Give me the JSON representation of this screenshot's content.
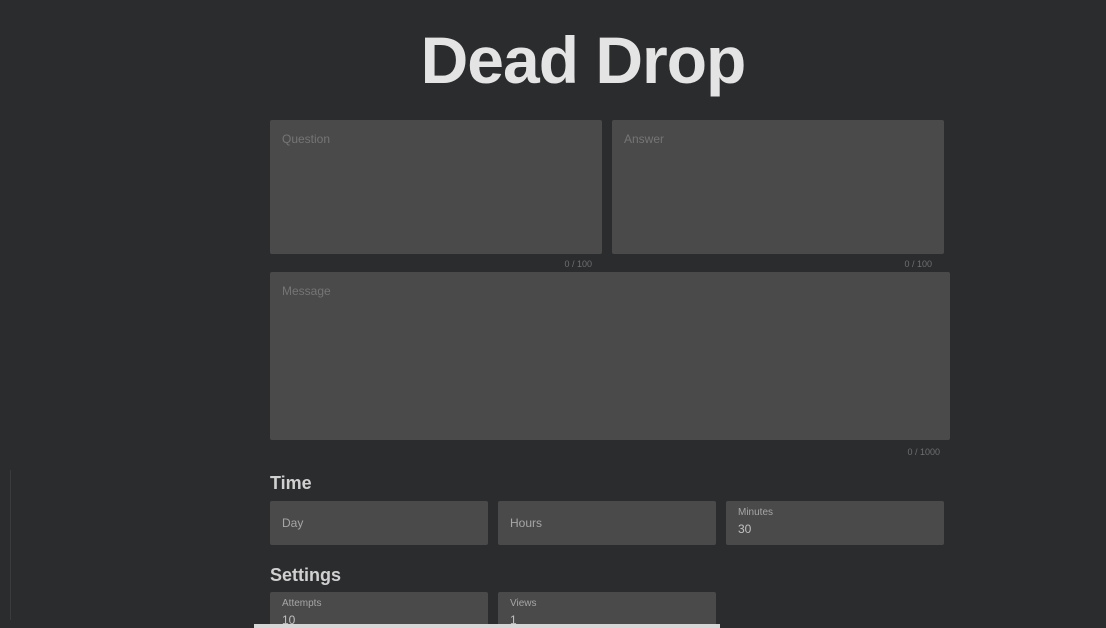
{
  "app": {
    "title": "Dead Drop"
  },
  "top_fields": {
    "question": {
      "placeholder": "Question",
      "counter": "0 / 100"
    },
    "answer": {
      "placeholder": "Answer",
      "counter": "0 / 100"
    }
  },
  "message": {
    "placeholder": "Message",
    "counter": "0 / 1000"
  },
  "time": {
    "label": "Time",
    "day": {
      "label": "Day"
    },
    "hours": {
      "label": "Hours"
    },
    "minutes": {
      "label": "Minutes",
      "value": "30"
    }
  },
  "settings": {
    "label": "Settings",
    "attempts": {
      "label": "Attempts",
      "value": "10"
    },
    "views": {
      "label": "Views",
      "value": "1"
    }
  }
}
